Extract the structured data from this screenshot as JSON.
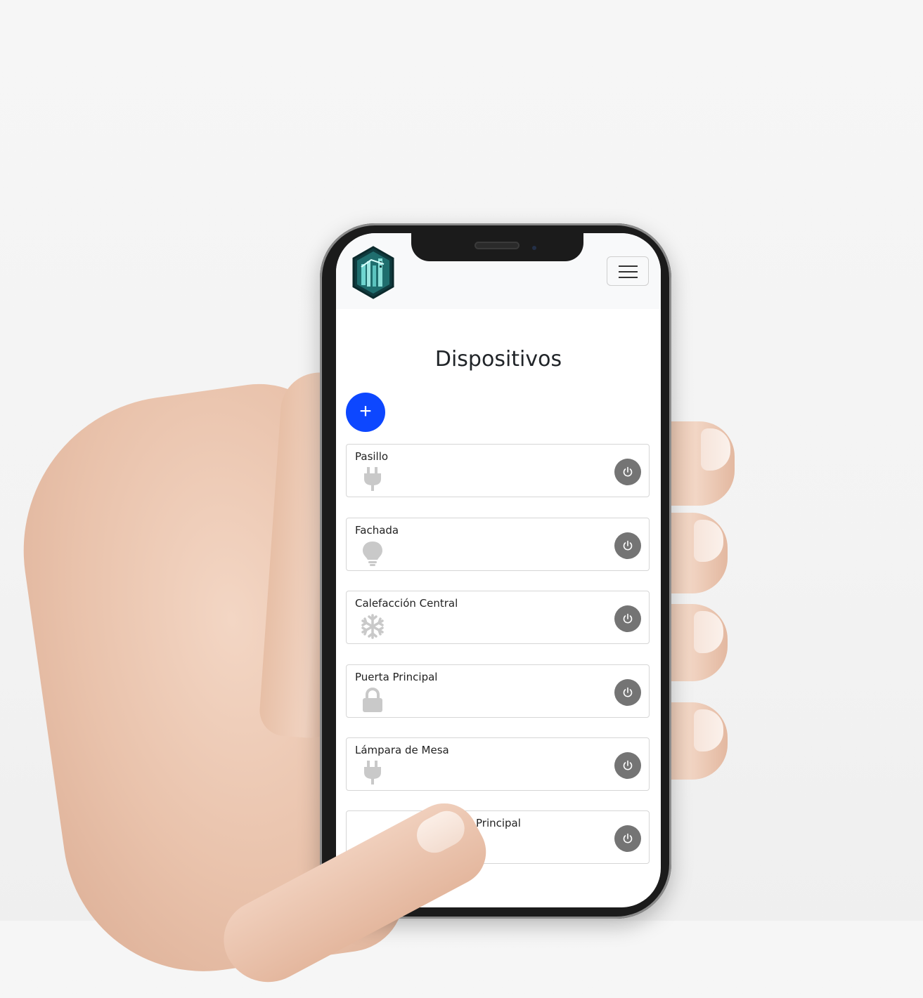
{
  "app": {
    "logo_alt": "logo",
    "menu_icon": "hamburger-icon",
    "page_title": "Dispositivos",
    "add_button_label": "+",
    "colors": {
      "accent": "#0d47ff",
      "power_button": "#747474",
      "icon_gray": "#c9c9c9",
      "navbar_bg": "#f8f9fa"
    },
    "devices": [
      {
        "name": "Pasillo",
        "icon": "plug-icon"
      },
      {
        "name": "Fachada",
        "icon": "lightbulb-icon"
      },
      {
        "name": "Calefacción Central",
        "icon": "snowflake-icon"
      },
      {
        "name": "Puerta Principal",
        "icon": "lock-icon"
      },
      {
        "name": "Lámpara de Mesa",
        "icon": "plug-icon"
      },
      {
        "name": "Principal",
        "icon": "device-icon"
      }
    ],
    "power_icon": "power-icon"
  }
}
